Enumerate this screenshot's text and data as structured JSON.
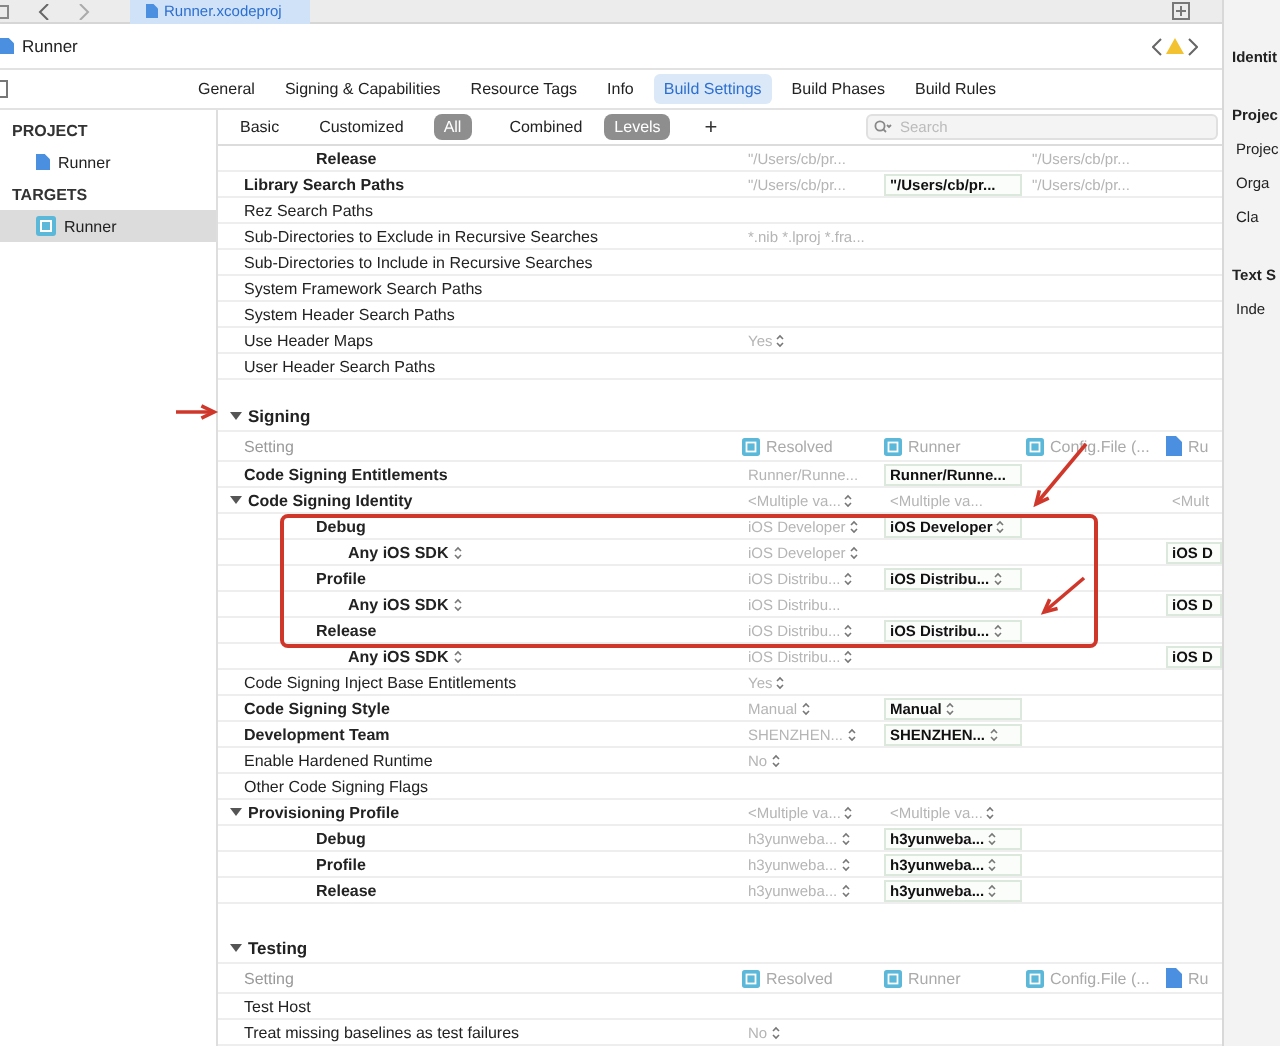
{
  "toolbar": {
    "file_tab": "Runner.xcodeproj"
  },
  "breadcrumb": {
    "title": "Runner"
  },
  "tabs": [
    {
      "label": "General",
      "selected": false
    },
    {
      "label": "Signing & Capabilities",
      "selected": false
    },
    {
      "label": "Resource Tags",
      "selected": false
    },
    {
      "label": "Info",
      "selected": false
    },
    {
      "label": "Build Settings",
      "selected": true
    },
    {
      "label": "Build Phases",
      "selected": false
    },
    {
      "label": "Build Rules",
      "selected": false
    }
  ],
  "sidebar": {
    "groups": [
      {
        "heading": "PROJECT",
        "items": [
          {
            "label": "Runner",
            "kind": "project",
            "selected": false
          }
        ]
      },
      {
        "heading": "TARGETS",
        "items": [
          {
            "label": "Runner",
            "kind": "target",
            "selected": true
          }
        ]
      }
    ]
  },
  "filters": {
    "scope": [
      {
        "label": "Basic",
        "selected": false
      },
      {
        "label": "Customized",
        "selected": false
      },
      {
        "label": "All",
        "selected": true
      }
    ],
    "view": [
      {
        "label": "Combined",
        "selected": false
      },
      {
        "label": "Levels",
        "selected": true
      }
    ],
    "add": "+",
    "search": {
      "placeholder": "Search"
    }
  },
  "sections": [
    {
      "rows": [
        {
          "name": "Release",
          "bold": true,
          "child": true,
          "resolved": {
            "text": "\"/Users/cb/pr..."
          },
          "config": {
            "text": "\"/Users/cb/pr...",
            "emphasized": false
          }
        },
        {
          "name": "Library Search Paths",
          "bold": true,
          "resolved": {
            "text": "\"/Users/cb/pr..."
          },
          "target": {
            "text": "\"/Users/cb/pr...",
            "emphasized": true
          },
          "config": {
            "text": "\"/Users/cb/pr...",
            "emphasized": false
          }
        },
        {
          "name": "Rez Search Paths",
          "bold": false
        },
        {
          "name": "Sub-Directories to Exclude in Recursive Searches",
          "bold": false,
          "resolved": {
            "text": "*.nib *.lproj *.fra..."
          }
        },
        {
          "name": "Sub-Directories to Include in Recursive Searches",
          "bold": false
        },
        {
          "name": "System Framework Search Paths",
          "bold": false
        },
        {
          "name": "System Header Search Paths",
          "bold": false
        },
        {
          "name": "Use Header Maps",
          "bold": false,
          "resolved": {
            "text": "Yes",
            "popup": true
          }
        },
        {
          "name": "User Header Search Paths",
          "bold": false
        }
      ]
    },
    {
      "title": "Signing",
      "expanded": true,
      "columns": {
        "setting": "Setting",
        "resolved": "Resolved",
        "target": "Runner",
        "config": "Config.File (...",
        "project": "Ru"
      },
      "rows": [
        {
          "name": "Code Signing Entitlements",
          "bold": true,
          "resolved": {
            "text": "Runner/Runne..."
          },
          "target": {
            "text": "Runner/Runne...",
            "emphasized": true
          }
        },
        {
          "name": "Code Signing Identity",
          "bold": true,
          "expanded": true,
          "resolved": {
            "text": "<Multiple va...",
            "popup": true
          },
          "target": {
            "text": "<Multiple va...",
            "emphasized": false
          },
          "project": {
            "text": "<Mult",
            "emphasized": false
          },
          "children": [
            {
              "name": "Debug",
              "bold": true,
              "resolved": {
                "text": "iOS Developer",
                "popup": true
              },
              "target": {
                "text": "iOS Developer",
                "popup": true,
                "emphasized": true
              },
              "children": [
                {
                  "name": "Any iOS SDK",
                  "bold": true,
                  "popup": true,
                  "resolved": {
                    "text": "iOS Developer",
                    "popup": true
                  },
                  "project": {
                    "text": "iOS D",
                    "emphasized": true
                  }
                }
              ]
            },
            {
              "name": "Profile",
              "bold": true,
              "resolved": {
                "text": "iOS Distribu...",
                "popup": true
              },
              "target": {
                "text": "iOS Distribu...",
                "popup": true,
                "emphasized": true
              },
              "children": [
                {
                  "name": "Any iOS SDK",
                  "bold": true,
                  "popup": true,
                  "resolved": {
                    "text": "iOS Distribu..."
                  },
                  "project": {
                    "text": "iOS D",
                    "emphasized": true
                  }
                }
              ]
            },
            {
              "name": "Release",
              "bold": true,
              "resolved": {
                "text": "iOS Distribu...",
                "popup": true
              },
              "target": {
                "text": "iOS Distribu...",
                "popup": true,
                "emphasized": true
              },
              "children": [
                {
                  "name": "Any iOS SDK",
                  "bold": true,
                  "popup": true,
                  "resolved": {
                    "text": "iOS Distribu...",
                    "popup": true
                  },
                  "project": {
                    "text": "iOS D",
                    "emphasized": true
                  }
                }
              ]
            }
          ]
        },
        {
          "name": "Code Signing Inject Base Entitlements",
          "bold": false,
          "resolved": {
            "text": "Yes",
            "popup": true
          }
        },
        {
          "name": "Code Signing Style",
          "bold": true,
          "resolved": {
            "text": "Manual",
            "popup": true
          },
          "target": {
            "text": "Manual",
            "popup": true,
            "emphasized": true
          }
        },
        {
          "name": "Development Team",
          "bold": true,
          "resolved": {
            "text": "SHENZHEN...",
            "popup": true
          },
          "target": {
            "text": "SHENZHEN...",
            "popup": true,
            "emphasized": true
          }
        },
        {
          "name": "Enable Hardened Runtime",
          "bold": false,
          "resolved": {
            "text": "No",
            "popup": true
          }
        },
        {
          "name": "Other Code Signing Flags",
          "bold": false
        },
        {
          "name": "Provisioning Profile",
          "bold": true,
          "expanded": true,
          "resolved": {
            "text": "<Multiple va...",
            "popup": true
          },
          "target": {
            "text": "<Multiple va...",
            "popup": true,
            "emphasized": false
          },
          "children": [
            {
              "name": "Debug",
              "bold": true,
              "resolved": {
                "text": "h3yunweba...",
                "popup": true
              },
              "target": {
                "text": "h3yunweba...",
                "popup": true,
                "emphasized": true
              }
            },
            {
              "name": "Profile",
              "bold": true,
              "resolved": {
                "text": "h3yunweba...",
                "popup": true
              },
              "target": {
                "text": "h3yunweba...",
                "popup": true,
                "emphasized": true
              }
            },
            {
              "name": "Release",
              "bold": true,
              "resolved": {
                "text": "h3yunweba...",
                "popup": true
              },
              "target": {
                "text": "h3yunweba...",
                "popup": true,
                "emphasized": true
              }
            }
          ]
        }
      ]
    },
    {
      "title": "Testing",
      "expanded": true,
      "columns": {
        "setting": "Setting",
        "resolved": "Resolved",
        "target": "Runner",
        "config": "Config.File (...",
        "project": "Ru"
      },
      "rows": [
        {
          "name": "Test Host",
          "bold": false
        },
        {
          "name": "Treat missing baselines as test failures",
          "bold": false,
          "resolved": {
            "text": "No",
            "popup": true
          }
        }
      ]
    }
  ],
  "inspector": [
    {
      "text": "Identit",
      "kind": "heading"
    },
    {
      "text": "Projec",
      "kind": "heading"
    },
    {
      "text": "Projec",
      "kind": "label"
    },
    {
      "text": "Orga",
      "kind": "label"
    },
    {
      "text": "Cla",
      "kind": "label"
    },
    {
      "text": "Text S",
      "kind": "heading"
    },
    {
      "text": "Inde",
      "kind": "label"
    }
  ]
}
